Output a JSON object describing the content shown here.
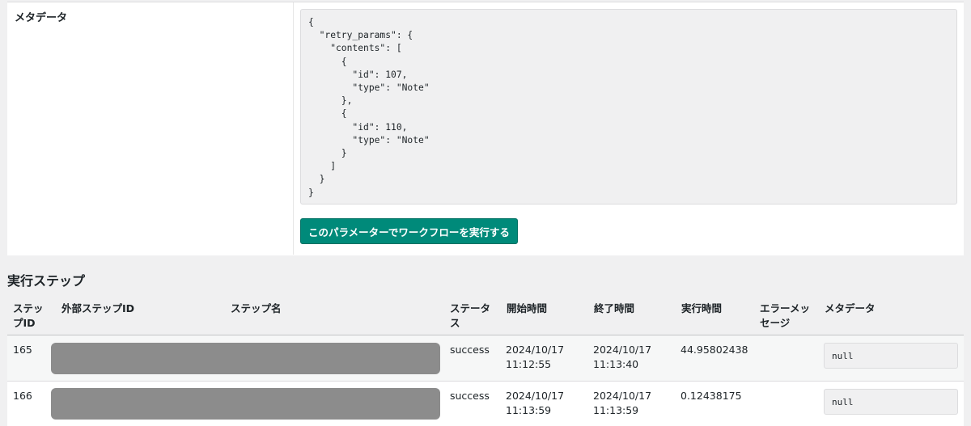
{
  "metadata_section": {
    "label": "メタデータ",
    "json_text": "{\n  \"retry_params\": {\n    \"contents\": [\n      {\n        \"id\": 107,\n        \"type\": \"Note\"\n      },\n      {\n        \"id\": 110,\n        \"type\": \"Note\"\n      }\n    ]\n  }\n}",
    "run_button_label": "このパラメーターでワークフローを実行する"
  },
  "steps_section": {
    "heading": "実行ステップ",
    "columns": {
      "step_id": "ステップID",
      "external_step_id": "外部ステップID",
      "step_name": "ステップ名",
      "status": "ステータス",
      "start_time": "開始時間",
      "end_time": "終了時間",
      "duration": "実行時間",
      "error_message": "エラーメッセージ",
      "metadata": "メタデータ"
    },
    "rows": [
      {
        "step_id": "165",
        "status": "success",
        "start_date": "2024/10/17",
        "start_time": "11:12:55",
        "end_date": "2024/10/17",
        "end_time": "11:13:40",
        "duration": "44.95802438",
        "error_message": "",
        "metadata": "null"
      },
      {
        "step_id": "166",
        "status": "success",
        "start_date": "2024/10/17",
        "start_time": "11:13:59",
        "end_date": "2024/10/17",
        "end_time": "11:13:59",
        "duration": "0.12438175",
        "error_message": "",
        "metadata": "null"
      }
    ]
  }
}
